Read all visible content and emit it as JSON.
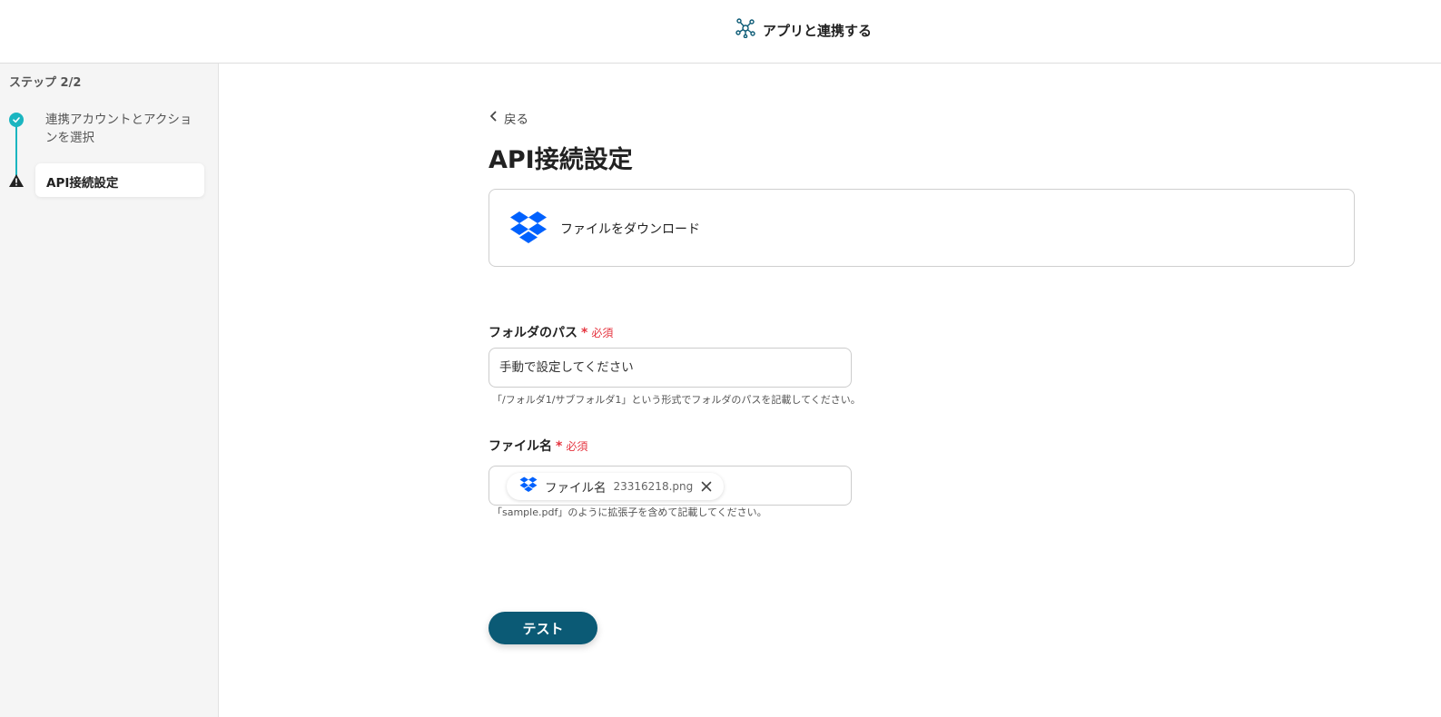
{
  "header": {
    "title": "アプリと連携する",
    "icon": "app-connect-icon"
  },
  "sidebar": {
    "step_count": "ステップ 2/2",
    "steps": [
      {
        "label": "連携アカウントとアクションを選択",
        "status": "completed",
        "icon": "check-circle-icon"
      },
      {
        "label": "API接続設定",
        "status": "current-warning",
        "icon": "warning-icon"
      }
    ],
    "accent_color": "#1ab5c0"
  },
  "main": {
    "back_label": "戻る",
    "title": "API接続設定",
    "action": {
      "label": "ファイルをダウンロード",
      "icon": "dropbox-icon"
    },
    "fields": [
      {
        "label": "フォルダのパス",
        "required_mark": "*",
        "required_text": "必須",
        "placeholder": "手動で設定してください",
        "hint": "「/フォルダ1/サブフォルダ1」という形式でフォルダのパスを記載してください。"
      },
      {
        "label": "ファイル名",
        "required_mark": "*",
        "required_text": "必須",
        "chip": {
          "label": "ファイル名",
          "value": "23316218.png",
          "icon": "dropbox-icon"
        },
        "hint": "「sample.pdf」のように拡張子を含めて記載してください。"
      }
    ],
    "test_button_label": "テスト",
    "button_color": "#0b5a75",
    "required_color": "#e5343f"
  }
}
